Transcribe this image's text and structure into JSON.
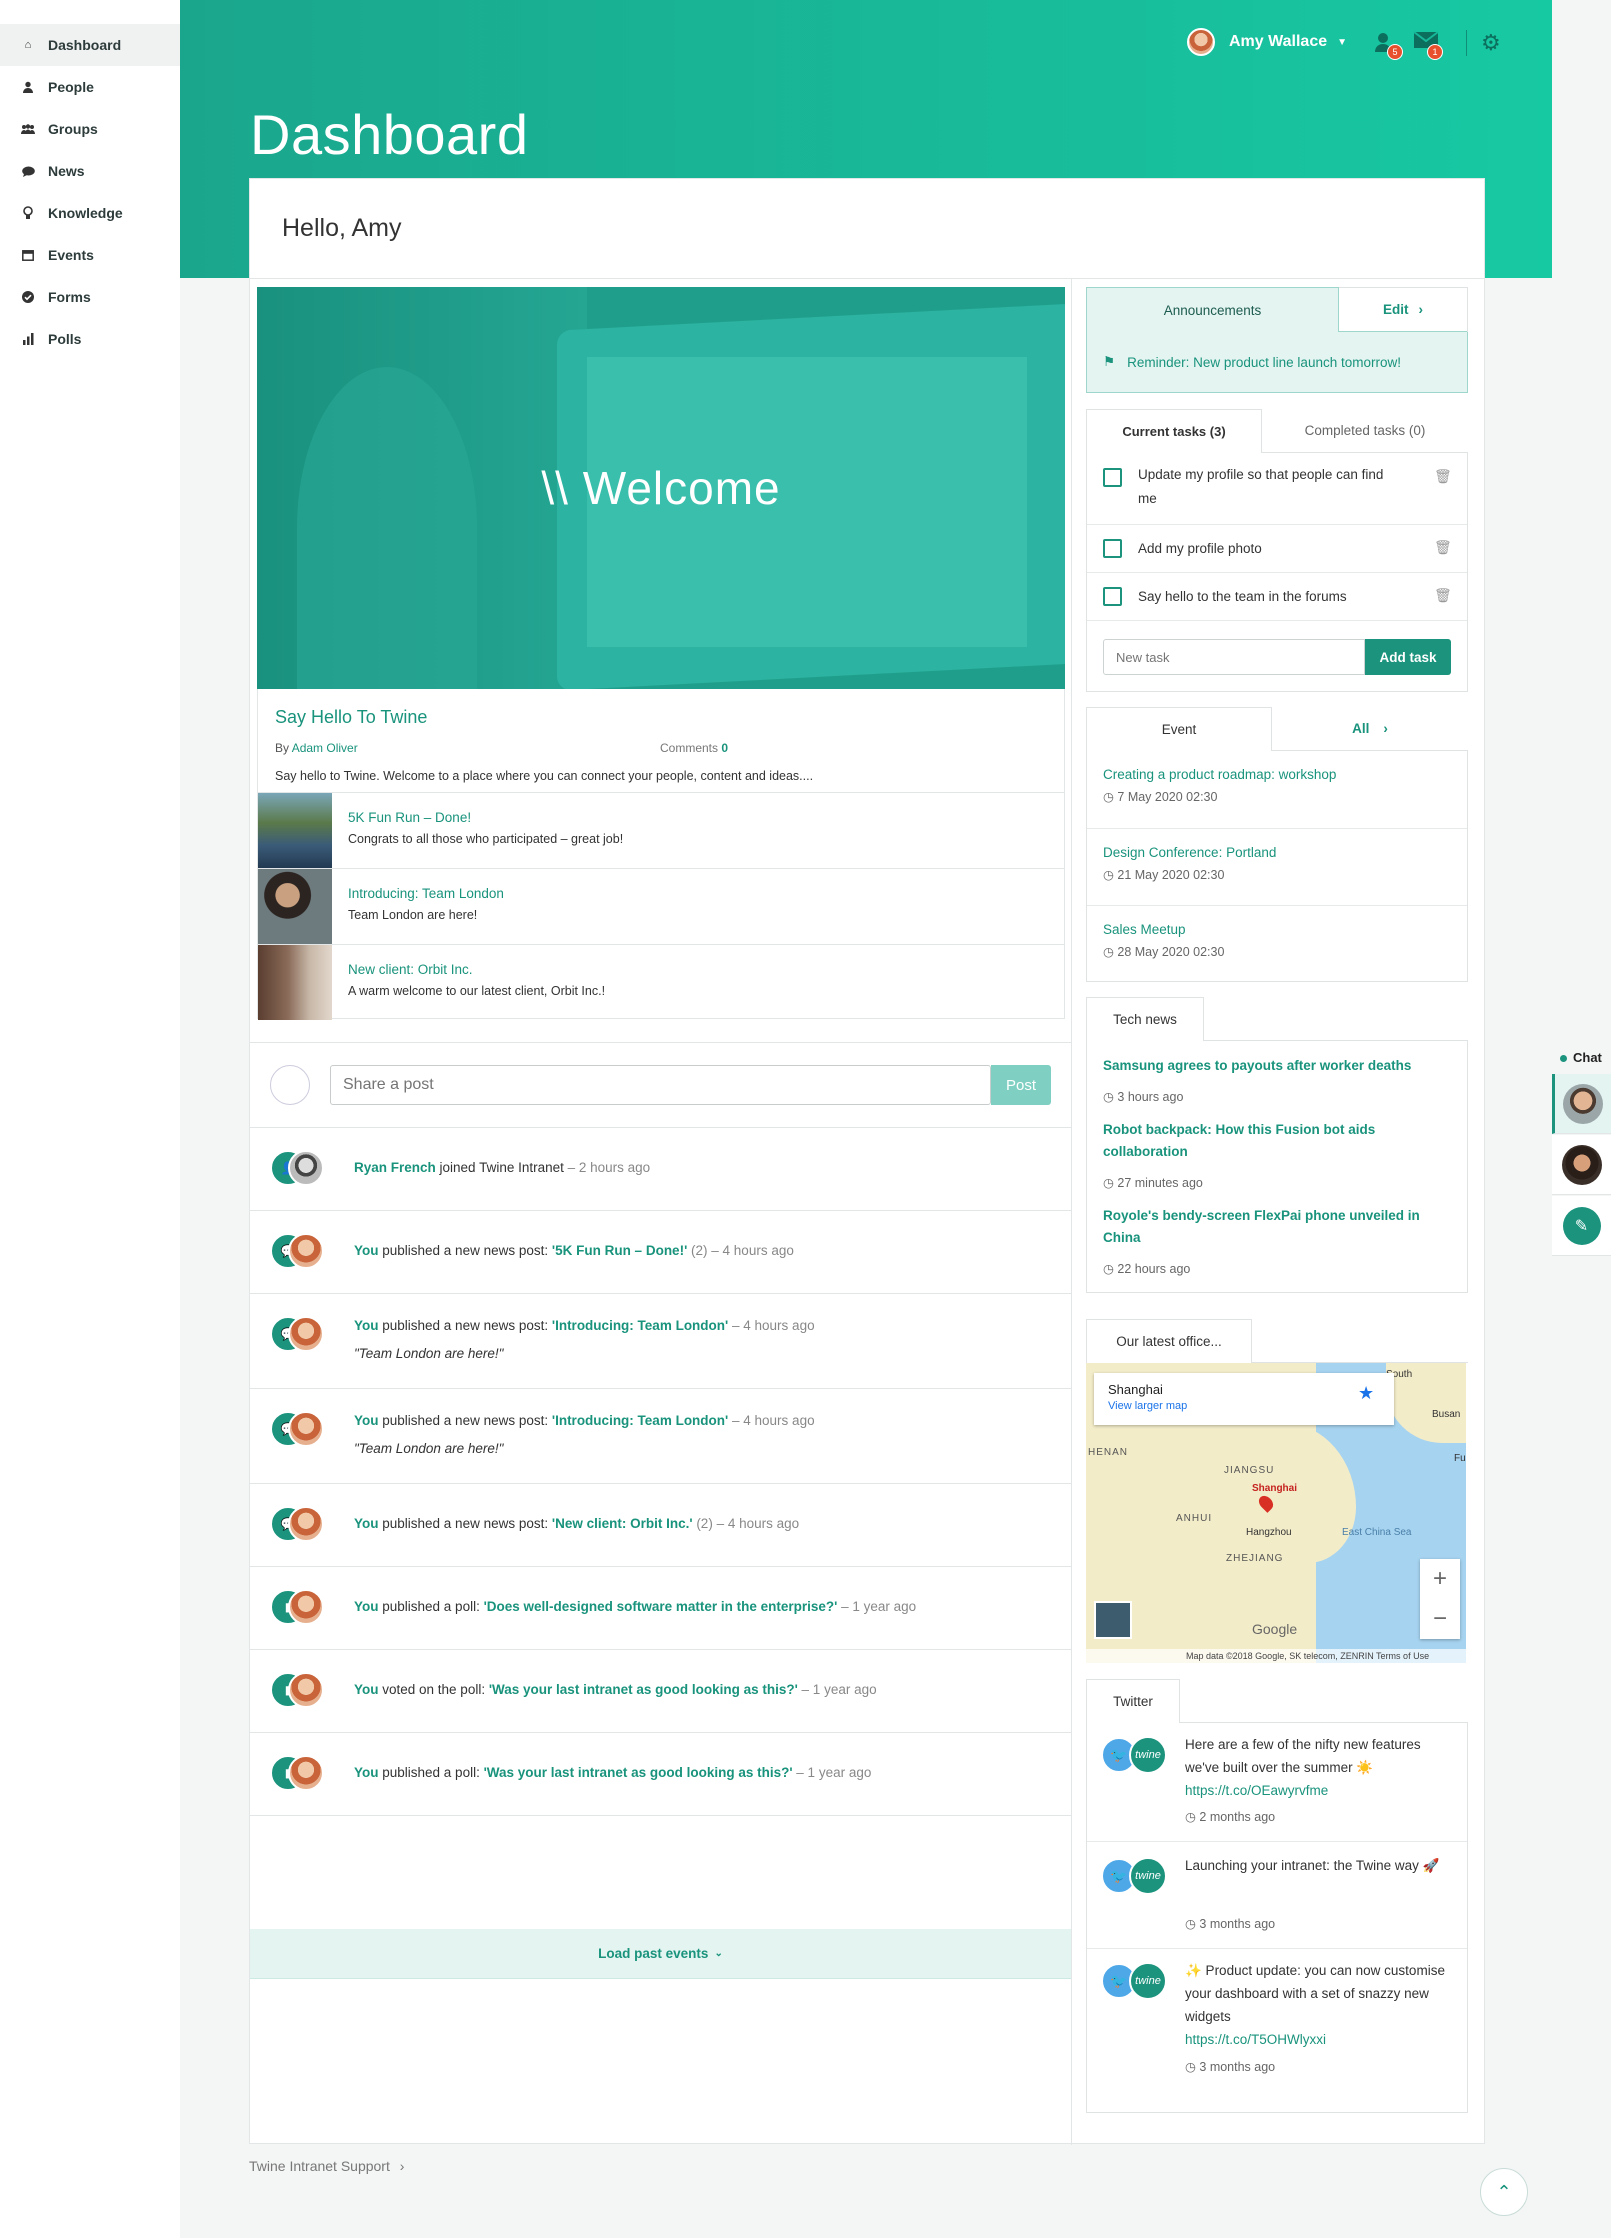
{
  "sidebar": {
    "items": [
      {
        "label": "Dashboard",
        "icon": "home-icon"
      },
      {
        "label": "People",
        "icon": "person-icon"
      },
      {
        "label": "Groups",
        "icon": "group-icon"
      },
      {
        "label": "News",
        "icon": "chat-bubble-icon"
      },
      {
        "label": "Knowledge",
        "icon": "lightbulb-icon"
      },
      {
        "label": "Events",
        "icon": "calendar-icon"
      },
      {
        "label": "Forms",
        "icon": "check-circle-icon"
      },
      {
        "label": "Polls",
        "icon": "bar-chart-icon"
      }
    ]
  },
  "header": {
    "title": "Dashboard",
    "user_name": "Amy Wallace",
    "notification_count": "5",
    "message_count": "1"
  },
  "greeting": "Hello, Amy",
  "hero": {
    "title": "\\\\ Welcome",
    "post_title": "Say Hello To Twine",
    "by_label": "By",
    "author": "Adam Oliver",
    "comments_label": "Comments",
    "comments_count": "0",
    "excerpt": "Say hello to Twine. Welcome to a place where you can connect your people, content and ideas...."
  },
  "news_items": [
    {
      "title": "5K Fun Run – Done!",
      "desc": "Congrats to all those who participated – great job!"
    },
    {
      "title": "Introducing: Team London",
      "desc": "Team London are here!"
    },
    {
      "title": "New client: Orbit Inc.",
      "desc": "A warm welcome to our latest client, Orbit Inc.!"
    }
  ],
  "composer": {
    "placeholder": "Share a post",
    "post_label": "Post"
  },
  "activity": [
    {
      "actor": "Ryan French",
      "action": " joined Twine Intranet",
      "target": "",
      "extra": "",
      "time": " – 2 hours ago",
      "quote": ""
    },
    {
      "actor": "You",
      "action": " published a new news post: ",
      "target": "'5K Fun Run – Done!'",
      "extra": " (2)",
      "time": " – 4 hours ago",
      "quote": ""
    },
    {
      "actor": "You",
      "action": " published a new news post: ",
      "target": "'Introducing: Team London'",
      "extra": "",
      "time": " – 4 hours ago",
      "quote": "\"Team London are here!\""
    },
    {
      "actor": "You",
      "action": " published a new news post: ",
      "target": "'Introducing: Team London'",
      "extra": "",
      "time": " – 4 hours ago",
      "quote": "\"Team London are here!\""
    },
    {
      "actor": "You",
      "action": " published a new news post: ",
      "target": "'New client: Orbit Inc.'",
      "extra": " (2)",
      "time": " – 4 hours ago",
      "quote": ""
    },
    {
      "actor": "You",
      "action": " published a poll: ",
      "target": "'Does well-designed software matter in the enterprise?'",
      "extra": "",
      "time": " – 1 year ago",
      "quote": ""
    },
    {
      "actor": "You",
      "action": " voted on the poll: ",
      "target": "'Was your last intranet as good looking as this?'",
      "extra": "",
      "time": " – 1 year ago",
      "quote": ""
    },
    {
      "actor": "You",
      "action": " published a poll: ",
      "target": "'Was your last intranet as good looking as this?'",
      "extra": "",
      "time": " – 1 year ago",
      "quote": ""
    }
  ],
  "load_past": "Load past events",
  "announcements": {
    "tab": "Announcements",
    "edit": "Edit",
    "message": "Reminder: New product line launch tomorrow!"
  },
  "tasks": {
    "current_tab": "Current tasks (3)",
    "completed_tab": "Completed tasks (0)",
    "items": [
      "Update my profile so that people can find me",
      "Add my profile photo",
      "Say hello to the team in the forums"
    ],
    "new_placeholder": "New task",
    "add_label": "Add task"
  },
  "events": {
    "tab": "Event",
    "all": "All",
    "items": [
      {
        "title": "Creating a product roadmap: workshop",
        "date": "7 May 2020 02:30"
      },
      {
        "title": "Design Conference: Portland",
        "date": "21 May 2020 02:30"
      },
      {
        "title": "Sales Meetup",
        "date": "28 May 2020 02:30"
      }
    ]
  },
  "tech_news": {
    "tab": "Tech news",
    "items": [
      {
        "title": "Samsung agrees to payouts after worker deaths",
        "time": "3 hours ago"
      },
      {
        "title": "Robot backpack: How this Fusion bot aids collaboration",
        "time": "27 minutes ago"
      },
      {
        "title": "Royole's bendy-screen FlexPai phone unveiled in China",
        "time": "22 hours ago"
      }
    ]
  },
  "office": {
    "tab": "Our latest office...",
    "place": "Shanghai",
    "view_larger": "View larger map",
    "labels": [
      "HENAN",
      "JIANGSU",
      "ANHUI",
      "Shanghai",
      "Hangzhou",
      "ZHEJIANG",
      "East China Sea",
      "South",
      "Busan",
      "Fu"
    ],
    "attribution": "Map data ©2018 Google, SK telecom, ZENRIN   Terms of Use",
    "google": "Google"
  },
  "twitter": {
    "tab": "Twitter",
    "items": [
      {
        "text": "Here are a few of the nifty new features we've built over the summer ☀️",
        "link": "https://t.co/OEawyrvfme",
        "time": "2 months ago"
      },
      {
        "text": "Launching your intranet: the Twine way 🚀",
        "link": "",
        "time": "3 months ago"
      },
      {
        "text": "✨ Product update: you can now customise your dashboard with a set of snazzy new widgets",
        "link": "https://t.co/T5OHWlyxxi",
        "time": "3 months ago"
      }
    ]
  },
  "chat": {
    "label": "Chat"
  },
  "footer": {
    "support": "Twine Intranet Support"
  },
  "colors": {
    "brand": "#1b937d",
    "header_start": "#1aa68d",
    "header_end": "#17c9a3",
    "badge": "#e8502d"
  }
}
